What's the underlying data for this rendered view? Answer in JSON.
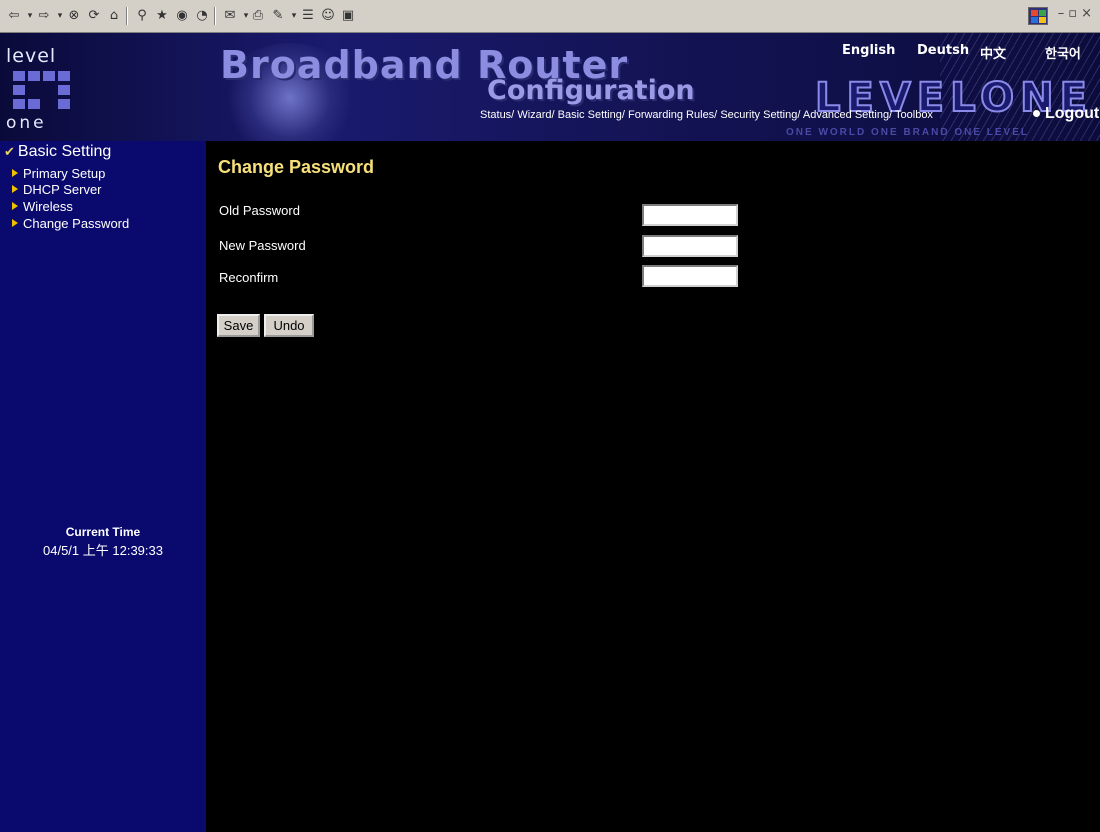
{
  "header": {
    "logo_top": "level",
    "logo_bottom": "one",
    "title": "Broadband Router",
    "subtitle": "Configuration",
    "brand": "LEVELONE",
    "slogan": "ONE WORLD ONE BRAND ONE LEVEL",
    "languages": [
      "English",
      "Deutsh",
      "中文",
      "한국어"
    ],
    "nav": [
      "Status/",
      "Wizard/",
      "Basic Setting/",
      "Forwarding Rules/",
      "Security Setting/",
      "Advanced Setting/",
      "Toolbox"
    ],
    "logout": "Logout"
  },
  "sidebar": {
    "section": "Basic Setting",
    "items": [
      {
        "label": "Primary Setup"
      },
      {
        "label": "DHCP Server"
      },
      {
        "label": "Wireless"
      },
      {
        "label": "Change Password"
      }
    ],
    "time_label": "Current Time",
    "time_value": "04/5/1 上午 12:39:33"
  },
  "main": {
    "title": "Change Password",
    "fields": [
      {
        "label": "Old Password",
        "value": ""
      },
      {
        "label": "New Password",
        "value": ""
      },
      {
        "label": "Reconfirm",
        "value": ""
      }
    ],
    "buttons": {
      "save": "Save",
      "undo": "Undo"
    }
  },
  "colors": {
    "sidebar_bg": "#0a0a6e",
    "title_color": "#f7e07a",
    "arrow_color": "#f0c000"
  },
  "icons": [
    "back-icon",
    "forward-icon",
    "stop-icon",
    "refresh-icon",
    "home-icon",
    "search-icon",
    "favorites-icon",
    "history-icon",
    "media-icon",
    "mail-icon",
    "print-icon",
    "edit-icon",
    "discuss-icon",
    "messenger-icon",
    "research-icon"
  ]
}
